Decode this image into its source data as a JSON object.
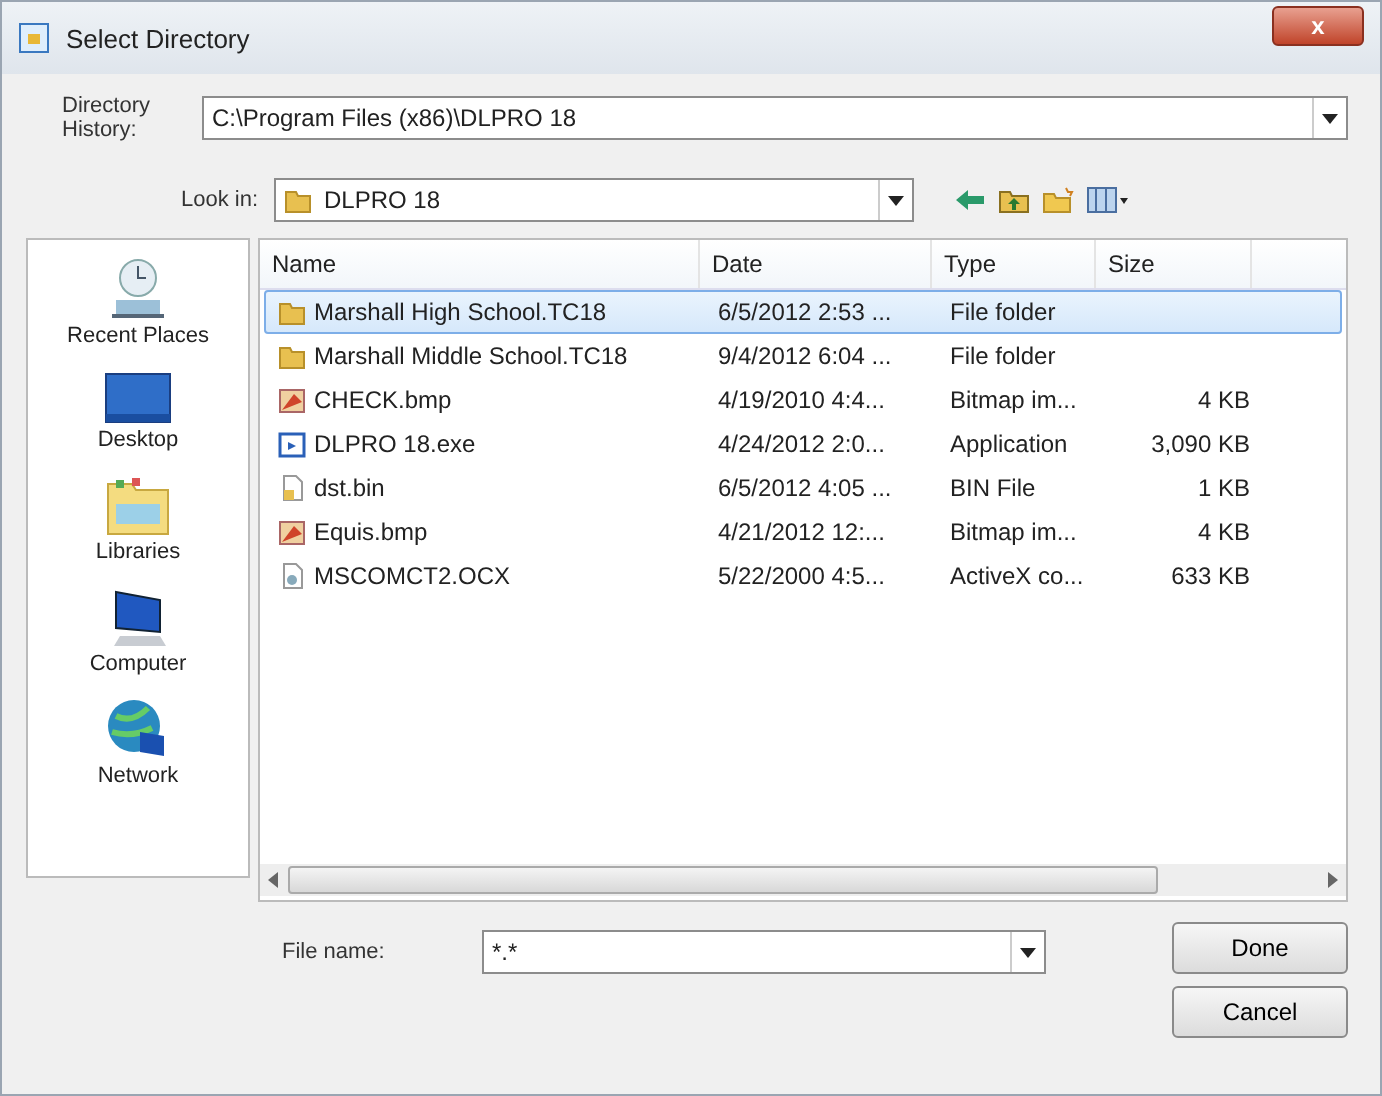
{
  "window": {
    "title": "Select Directory",
    "close_label": "x"
  },
  "directory_history": {
    "label": "Directory History:",
    "value": "C:\\Program Files (x86)\\DLPRO 18"
  },
  "look_in": {
    "label": "Look in:",
    "value": "DLPRO 18"
  },
  "places": [
    {
      "label": "Recent Places",
      "kind": "recent"
    },
    {
      "label": "Desktop",
      "kind": "desktop"
    },
    {
      "label": "Libraries",
      "kind": "libraries"
    },
    {
      "label": "Computer",
      "kind": "computer"
    },
    {
      "label": "Network",
      "kind": "network"
    }
  ],
  "table": {
    "columns": [
      "Name",
      "Date",
      "Type",
      "Size"
    ],
    "rows": [
      {
        "kind": "folder",
        "selected": true,
        "cells": [
          "Marshall High School.TC18",
          "6/5/2012 2:53 ...",
          "File folder",
          ""
        ]
      },
      {
        "kind": "folder",
        "selected": false,
        "cells": [
          "Marshall Middle School.TC18",
          "9/4/2012 6:04 ...",
          "File folder",
          ""
        ]
      },
      {
        "kind": "bitmap",
        "selected": false,
        "cells": [
          "CHECK.bmp",
          "4/19/2010 4:4...",
          "Bitmap im...",
          "4 KB"
        ]
      },
      {
        "kind": "exe",
        "selected": false,
        "cells": [
          "DLPRO 18.exe",
          "4/24/2012 2:0...",
          "Application",
          "3,090 KB"
        ]
      },
      {
        "kind": "file",
        "selected": false,
        "cells": [
          "dst.bin",
          "6/5/2012 4:05 ...",
          "BIN File",
          "1 KB"
        ]
      },
      {
        "kind": "bitmap",
        "selected": false,
        "cells": [
          "Equis.bmp",
          "4/21/2012 12:...",
          "Bitmap im...",
          "4 KB"
        ]
      },
      {
        "kind": "ocx",
        "selected": false,
        "cells": [
          "MSCOMCT2.OCX",
          "5/22/2000 4:5...",
          "ActiveX co...",
          "633 KB"
        ]
      }
    ]
  },
  "file_name": {
    "label": "File name:",
    "value": "*.*"
  },
  "buttons": [
    "Done",
    "Cancel"
  ]
}
